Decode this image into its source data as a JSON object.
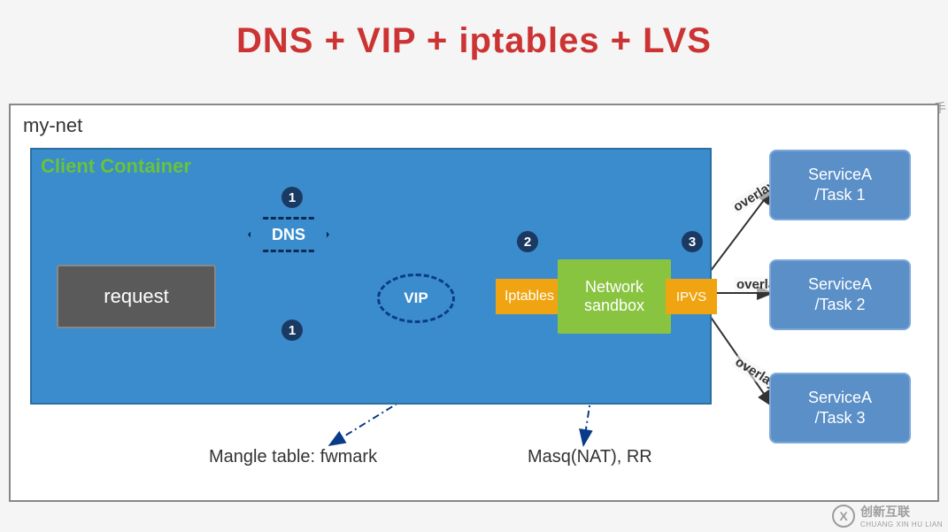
{
  "title": "DNS + VIP + iptables + LVS",
  "frame_label": "my-net",
  "client_container_label": "Client Container",
  "request_label": "request",
  "dns_label": "DNS",
  "vip_label": "VIP",
  "iptables_label": "Iptables",
  "network_sandbox_line1": "Network",
  "network_sandbox_line2": "sandbox",
  "ipvs_label": "IPVS",
  "steps": {
    "s1": "1",
    "s1b": "1",
    "s2": "2",
    "s3": "3"
  },
  "services": {
    "a": {
      "name": "ServiceA",
      "task": "/Task 1"
    },
    "b": {
      "name": "ServiceA",
      "task": "/Task 2"
    },
    "c": {
      "name": "ServiceA",
      "task": "/Task 3"
    }
  },
  "overlay_label": "overlay",
  "footer": {
    "mangle": "Mangle table: fwmark",
    "masq": "Masq(NAT), RR"
  },
  "watermark": {
    "brand": "创新互联",
    "sub": "CHUANG XIN HU LIAN"
  },
  "side_text": "一手"
}
